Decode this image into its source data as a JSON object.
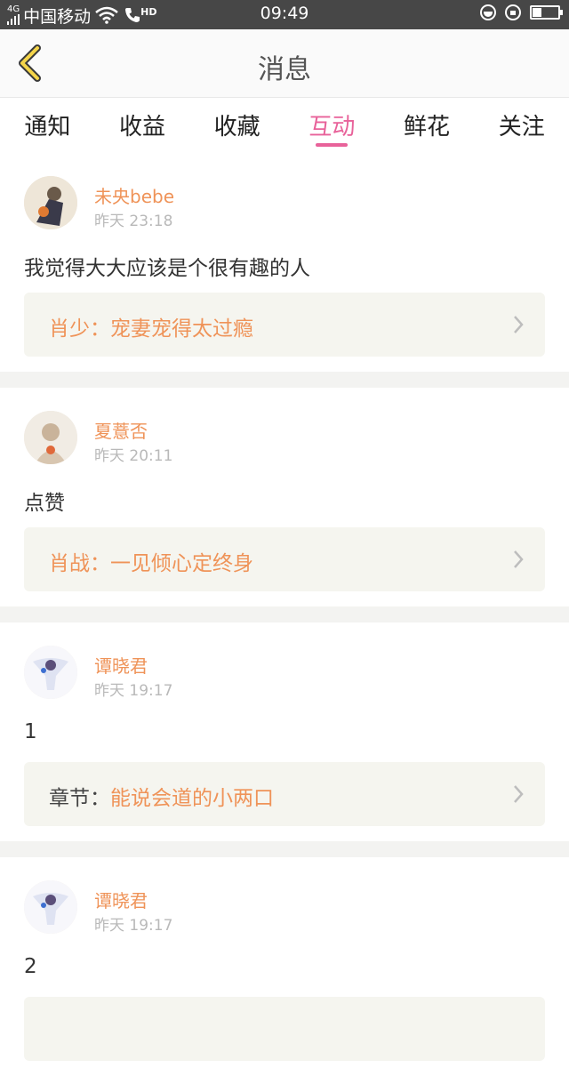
{
  "status_bar": {
    "network": "4G",
    "carrier": "中国移动",
    "hd": "HD",
    "time": "09:49"
  },
  "header": {
    "title": "消息"
  },
  "tabs": [
    {
      "label": "通知"
    },
    {
      "label": "收益"
    },
    {
      "label": "收藏"
    },
    {
      "label": "互动",
      "active": true
    },
    {
      "label": "鲜花"
    },
    {
      "label": "关注"
    }
  ],
  "items": [
    {
      "name": "未央bebe",
      "time": "昨天 23:18",
      "message": "我觉得大大应该是个很有趣的人",
      "ref_prefix": "肖少：",
      "ref_title": "宠妻宠得太过瘾"
    },
    {
      "name": "夏薏否",
      "time": "昨天 20:11",
      "message": "点赞",
      "ref_prefix": "肖战：",
      "ref_title": "一见倾心定终身"
    },
    {
      "name": "谭晓君",
      "time": "昨天 19:17",
      "message": "1",
      "ref_prefix": "章节：",
      "ref_title": "能说会道的小两口"
    },
    {
      "name": "谭晓君",
      "time": "昨天 19:17",
      "message": "2",
      "ref_prefix": "",
      "ref_title": ""
    }
  ],
  "colors": {
    "accent": "#e8629a",
    "name": "#ef9358",
    "status_bar": "#474747"
  }
}
